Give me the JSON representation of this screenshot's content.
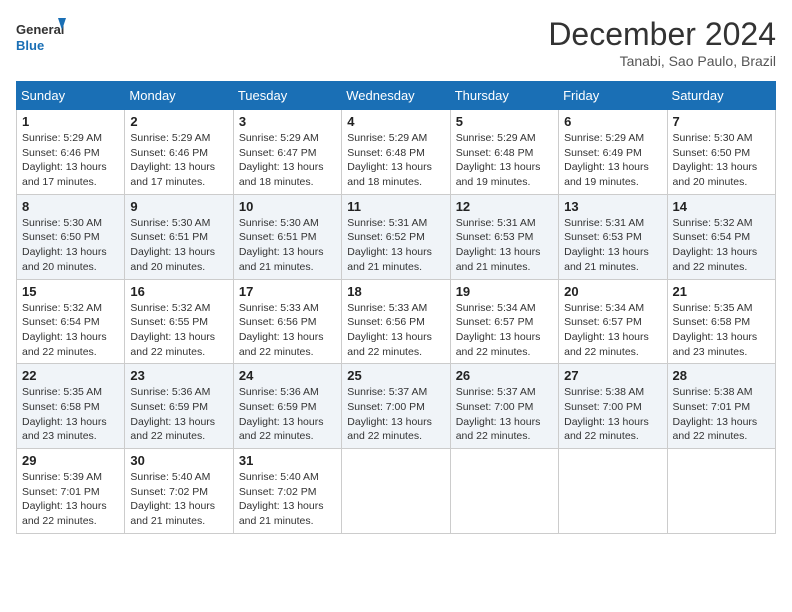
{
  "header": {
    "logo_line1": "General",
    "logo_line2": "Blue",
    "month": "December 2024",
    "location": "Tanabi, Sao Paulo, Brazil"
  },
  "weekdays": [
    "Sunday",
    "Monday",
    "Tuesday",
    "Wednesday",
    "Thursday",
    "Friday",
    "Saturday"
  ],
  "weeks": [
    [
      {
        "day": "1",
        "sunrise": "5:29 AM",
        "sunset": "6:46 PM",
        "daylight": "13 hours and 17 minutes."
      },
      {
        "day": "2",
        "sunrise": "5:29 AM",
        "sunset": "6:46 PM",
        "daylight": "13 hours and 17 minutes."
      },
      {
        "day": "3",
        "sunrise": "5:29 AM",
        "sunset": "6:47 PM",
        "daylight": "13 hours and 18 minutes."
      },
      {
        "day": "4",
        "sunrise": "5:29 AM",
        "sunset": "6:48 PM",
        "daylight": "13 hours and 18 minutes."
      },
      {
        "day": "5",
        "sunrise": "5:29 AM",
        "sunset": "6:48 PM",
        "daylight": "13 hours and 19 minutes."
      },
      {
        "day": "6",
        "sunrise": "5:29 AM",
        "sunset": "6:49 PM",
        "daylight": "13 hours and 19 minutes."
      },
      {
        "day": "7",
        "sunrise": "5:30 AM",
        "sunset": "6:50 PM",
        "daylight": "13 hours and 20 minutes."
      }
    ],
    [
      {
        "day": "8",
        "sunrise": "5:30 AM",
        "sunset": "6:50 PM",
        "daylight": "13 hours and 20 minutes."
      },
      {
        "day": "9",
        "sunrise": "5:30 AM",
        "sunset": "6:51 PM",
        "daylight": "13 hours and 20 minutes."
      },
      {
        "day": "10",
        "sunrise": "5:30 AM",
        "sunset": "6:51 PM",
        "daylight": "13 hours and 21 minutes."
      },
      {
        "day": "11",
        "sunrise": "5:31 AM",
        "sunset": "6:52 PM",
        "daylight": "13 hours and 21 minutes."
      },
      {
        "day": "12",
        "sunrise": "5:31 AM",
        "sunset": "6:53 PM",
        "daylight": "13 hours and 21 minutes."
      },
      {
        "day": "13",
        "sunrise": "5:31 AM",
        "sunset": "6:53 PM",
        "daylight": "13 hours and 21 minutes."
      },
      {
        "day": "14",
        "sunrise": "5:32 AM",
        "sunset": "6:54 PM",
        "daylight": "13 hours and 22 minutes."
      }
    ],
    [
      {
        "day": "15",
        "sunrise": "5:32 AM",
        "sunset": "6:54 PM",
        "daylight": "13 hours and 22 minutes."
      },
      {
        "day": "16",
        "sunrise": "5:32 AM",
        "sunset": "6:55 PM",
        "daylight": "13 hours and 22 minutes."
      },
      {
        "day": "17",
        "sunrise": "5:33 AM",
        "sunset": "6:56 PM",
        "daylight": "13 hours and 22 minutes."
      },
      {
        "day": "18",
        "sunrise": "5:33 AM",
        "sunset": "6:56 PM",
        "daylight": "13 hours and 22 minutes."
      },
      {
        "day": "19",
        "sunrise": "5:34 AM",
        "sunset": "6:57 PM",
        "daylight": "13 hours and 22 minutes."
      },
      {
        "day": "20",
        "sunrise": "5:34 AM",
        "sunset": "6:57 PM",
        "daylight": "13 hours and 22 minutes."
      },
      {
        "day": "21",
        "sunrise": "5:35 AM",
        "sunset": "6:58 PM",
        "daylight": "13 hours and 23 minutes."
      }
    ],
    [
      {
        "day": "22",
        "sunrise": "5:35 AM",
        "sunset": "6:58 PM",
        "daylight": "13 hours and 23 minutes."
      },
      {
        "day": "23",
        "sunrise": "5:36 AM",
        "sunset": "6:59 PM",
        "daylight": "13 hours and 22 minutes."
      },
      {
        "day": "24",
        "sunrise": "5:36 AM",
        "sunset": "6:59 PM",
        "daylight": "13 hours and 22 minutes."
      },
      {
        "day": "25",
        "sunrise": "5:37 AM",
        "sunset": "7:00 PM",
        "daylight": "13 hours and 22 minutes."
      },
      {
        "day": "26",
        "sunrise": "5:37 AM",
        "sunset": "7:00 PM",
        "daylight": "13 hours and 22 minutes."
      },
      {
        "day": "27",
        "sunrise": "5:38 AM",
        "sunset": "7:00 PM",
        "daylight": "13 hours and 22 minutes."
      },
      {
        "day": "28",
        "sunrise": "5:38 AM",
        "sunset": "7:01 PM",
        "daylight": "13 hours and 22 minutes."
      }
    ],
    [
      {
        "day": "29",
        "sunrise": "5:39 AM",
        "sunset": "7:01 PM",
        "daylight": "13 hours and 22 minutes."
      },
      {
        "day": "30",
        "sunrise": "5:40 AM",
        "sunset": "7:02 PM",
        "daylight": "13 hours and 21 minutes."
      },
      {
        "day": "31",
        "sunrise": "5:40 AM",
        "sunset": "7:02 PM",
        "daylight": "13 hours and 21 minutes."
      },
      null,
      null,
      null,
      null
    ]
  ]
}
